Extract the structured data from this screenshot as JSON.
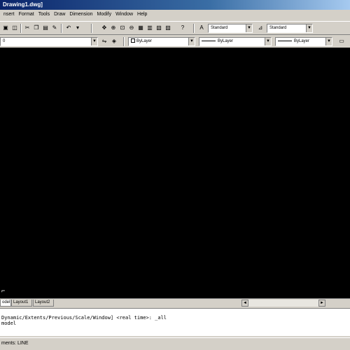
{
  "window": {
    "title": "Drawing1.dwg]"
  },
  "menu": [
    "nsert",
    "Format",
    "Tools",
    "Draw",
    "Dimension",
    "Modify",
    "Window",
    "Help"
  ],
  "toolbar": {
    "textstyle_value": "Standard",
    "dimstyle_value": "Standard"
  },
  "properties": {
    "layer_value": "0",
    "color_value": "ByLayer",
    "linetype_value": "ByLayer",
    "lineweight_value": "ByLayer"
  },
  "tabs": [
    "odel",
    "Layout1",
    "Layout2"
  ],
  "command_lines": [
    "Dynamic/Extents/Previous/Scale/Window] <real time>: _all",
    "model"
  ],
  "status": {
    "text": "ments: LINE"
  }
}
